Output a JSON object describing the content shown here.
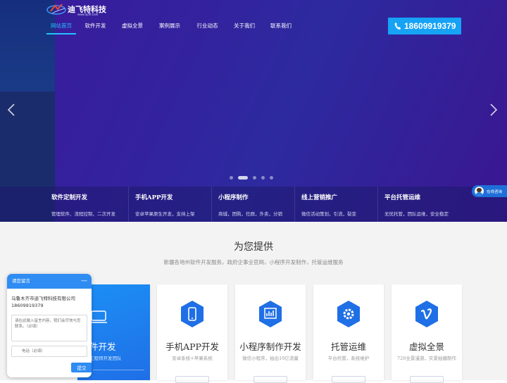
{
  "logo": {
    "name": "迪飞特科技",
    "url": "www.xjdft.com"
  },
  "nav": [
    {
      "label": "网站首页",
      "active": true
    },
    {
      "label": "软件开发",
      "active": false
    },
    {
      "label": "虚拟全景",
      "active": false
    },
    {
      "label": "案例展示",
      "active": false
    },
    {
      "label": "行业动态",
      "active": false
    },
    {
      "label": "关于我们",
      "active": false
    },
    {
      "label": "联系我们",
      "active": false
    }
  ],
  "phone": "18609919379",
  "carousel": {
    "slide_count": 5,
    "active_index": 1
  },
  "features": [
    {
      "title": "软件定制开发",
      "desc": "管理软件、流程控制、二次开发"
    },
    {
      "title": "手机APP开发",
      "desc": "安卓苹果原生开发，支持上架"
    },
    {
      "title": "小程序制作",
      "desc": "商城，团购，社群，外卖，分销"
    },
    {
      "title": "线上营销推广",
      "desc": "微信活动策划，引流，裂变"
    },
    {
      "title": "平台托管运维",
      "desc": "无忧托管，团队运维，安全稳定"
    }
  ],
  "side_chat": {
    "label": "在线咨询"
  },
  "section": {
    "title": "为您提供",
    "subtitle": "新疆各地州软件开发服务，政府企事业官网，小程序开发制作，托管运维服务"
  },
  "cards": [
    {
      "title": "件开发",
      "desc": "工程师开发团队",
      "icon": "monitor-icon"
    },
    {
      "title": "手机APP开发",
      "desc": "安卓系统+苹果系统",
      "icon": "phone-icon"
    },
    {
      "title": "小程序制作开发",
      "desc": "微信小程序，拍出10亿流量",
      "icon": "chart-icon"
    },
    {
      "title": "托管运维",
      "desc": "平台托管，系统维护",
      "icon": "gear-icon"
    },
    {
      "title": "虚拟全景",
      "desc": "720全景漫游，实景拍摄制作",
      "icon": "vimeo-icon"
    }
  ],
  "chat": {
    "title": "请您留言",
    "minimize": "—",
    "company": "乌鲁木齐市迪飞特科技有限公司18609919379",
    "message_placeholder": "请在此输入留言内容，我们会尽快与您联系。（必填）",
    "phone_placeholder": "电话（必填）",
    "send": "提交"
  },
  "colors": {
    "accent": "#25c1ff",
    "phone_bg": "#16a2f5",
    "chat_blue": "#2f8cf3",
    "card_blue": "#1c8ff5"
  }
}
